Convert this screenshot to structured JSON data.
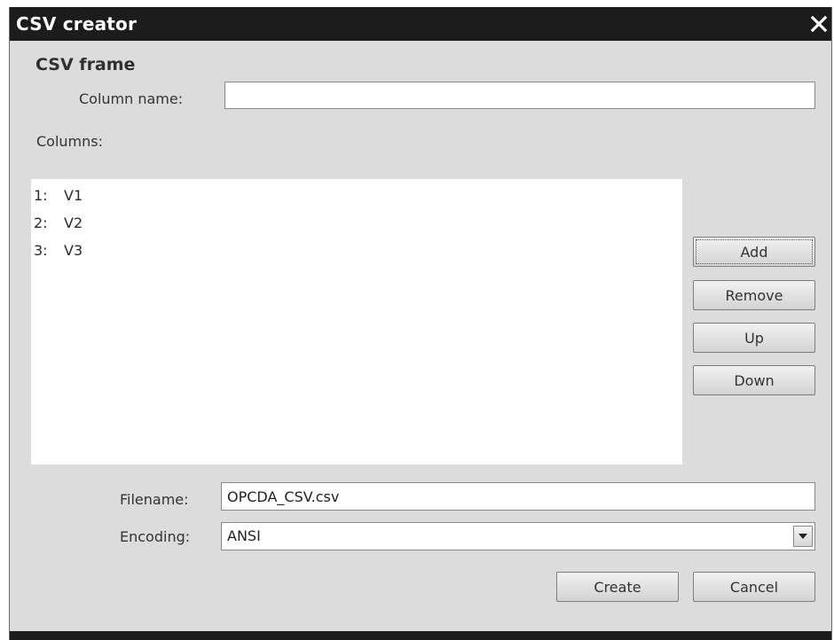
{
  "window": {
    "title": "CSV creator",
    "close_icon": "close-icon"
  },
  "frame": {
    "section_title": "CSV frame",
    "column_name_label": "Column name:",
    "column_name_value": "",
    "columns_label": "Columns:"
  },
  "columns": [
    {
      "index": "1:",
      "name": "V1"
    },
    {
      "index": "2:",
      "name": "V2"
    },
    {
      "index": "3:",
      "name": "V3"
    }
  ],
  "side_buttons": {
    "add": "Add",
    "remove": "Remove",
    "up": "Up",
    "down": "Down"
  },
  "file": {
    "filename_label": "Filename:",
    "filename_value": "OPCDA_CSV.csv",
    "encoding_label": "Encoding:",
    "encoding_value": "ANSI"
  },
  "footer": {
    "create": "Create",
    "cancel": "Cancel"
  },
  "colors": {
    "titlebar": "#1c1c1c",
    "dialog_bg": "#dcdcdc",
    "field_bg": "#ffffff"
  }
}
